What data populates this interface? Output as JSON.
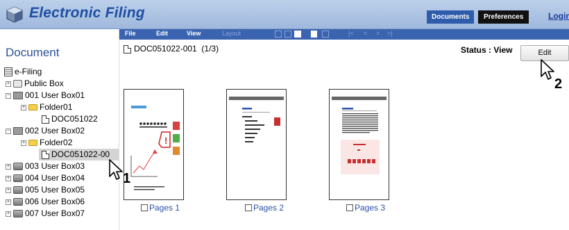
{
  "header": {
    "title": "Electronic Filing",
    "nav": {
      "documents": "Documents",
      "preferences": "Preferences",
      "login": "Login"
    }
  },
  "toolbar": {
    "file": "File",
    "edit": "Edit",
    "view": "View",
    "layout": "Layout",
    "nav_first": "|<",
    "nav_prev": "<",
    "nav_next": ">",
    "nav_last": ">|"
  },
  "sidebar": {
    "title": "Document",
    "root": "e-Filing",
    "items": [
      {
        "label": "Public Box",
        "level": 1,
        "icon": "public-box-icon"
      },
      {
        "label": "001 User Box01",
        "level": 1,
        "icon": "user-box-icon"
      },
      {
        "label": "Folder01",
        "level": 2,
        "icon": "folder-icon"
      },
      {
        "label": "DOC051022",
        "level": 3,
        "icon": "document-icon"
      },
      {
        "label": "002 User Box02",
        "level": 1,
        "icon": "user-box-icon"
      },
      {
        "label": "Folder02",
        "level": 2,
        "icon": "folder-icon"
      },
      {
        "label": "DOC051022-00",
        "level": 3,
        "icon": "document-icon",
        "selected": true
      },
      {
        "label": "003 User Box03",
        "level": 1,
        "icon": "user-box-icon"
      },
      {
        "label": "004 User Box04",
        "level": 1,
        "icon": "user-box-icon"
      },
      {
        "label": "005 User Box05",
        "level": 1,
        "icon": "user-box-icon"
      },
      {
        "label": "006 User Box06",
        "level": 1,
        "icon": "user-box-icon"
      },
      {
        "label": "007 User Box07",
        "level": 1,
        "icon": "user-box-icon"
      }
    ]
  },
  "document": {
    "name": "DOC051022-001",
    "page_info": "(1/3)",
    "status_label": "Status : View",
    "edit_button": "Edit"
  },
  "pages": [
    {
      "label": "Pages 1"
    },
    {
      "label": "Pages 2"
    },
    {
      "label": "Pages 3"
    }
  ],
  "callouts": {
    "one": "1",
    "two": "2"
  },
  "colors": {
    "brand": "#1f4ea1",
    "toolbar": "#3b64b0",
    "link": "#2b50a8"
  }
}
